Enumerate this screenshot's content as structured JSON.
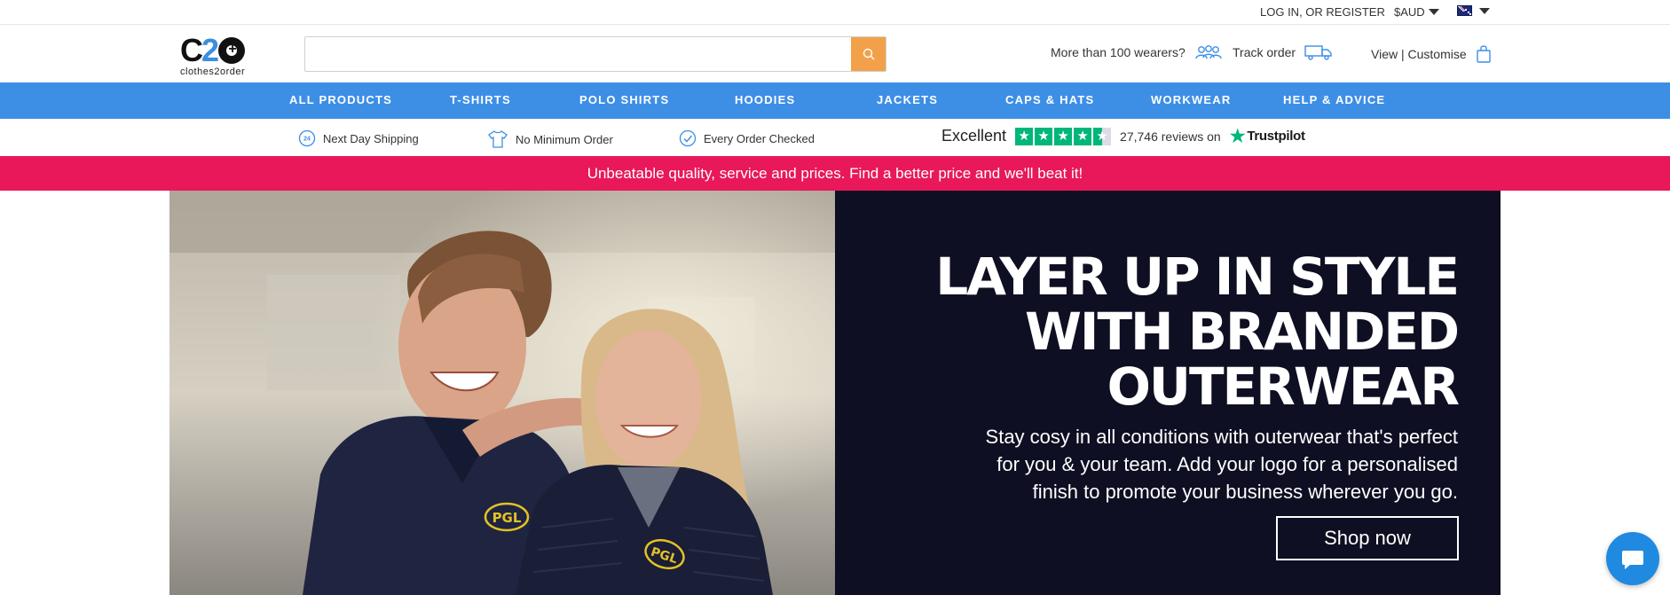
{
  "utility": {
    "login": "LOG IN, OR REGISTER",
    "currency": "$AUD",
    "region_flag_icon": "australia-flag-icon"
  },
  "header": {
    "logo_text": "clothes2order",
    "logo_mark": "C2O",
    "search": {
      "value": "",
      "placeholder": "",
      "button_icon": "search-icon"
    },
    "wearers": "More than 100 wearers?",
    "track_order": "Track order",
    "view_customise": "View | Customise"
  },
  "nav": {
    "items": [
      "ALL PRODUCTS",
      "T-SHIRTS",
      "POLO SHIRTS",
      "HOODIES",
      "JACKETS",
      "CAPS & HATS",
      "WORKWEAR",
      "HELP & ADVICE"
    ]
  },
  "usp": {
    "items": [
      "Next Day Shipping",
      "No Minimum Order",
      "Every Order Checked"
    ],
    "trustpilot": {
      "rating_word": "Excellent",
      "stars": 4.5,
      "reviews": "27,746 reviews on",
      "brand": "Trustpilot"
    }
  },
  "promo": {
    "text": "Unbeatable quality, service and prices. Find a better price and we'll beat it!"
  },
  "hero": {
    "title_line1": "LAYER UP IN STYLE",
    "title_line2": "WITH BRANDED",
    "title_line3": "OUTERWEAR",
    "subtitle": "Stay cosy in all conditions with outerwear that's perfect for you & your team. Add your logo for a personalised finish to promote your business wherever you go.",
    "cta": "Shop now",
    "jacket_logo": "PGL"
  },
  "colors": {
    "nav_blue": "#3d8fe6",
    "promo_pink": "#e8185a",
    "search_orange": "#f2a14a",
    "hero_dark": "#0f0f23",
    "trustpilot_green": "#00b67a"
  }
}
